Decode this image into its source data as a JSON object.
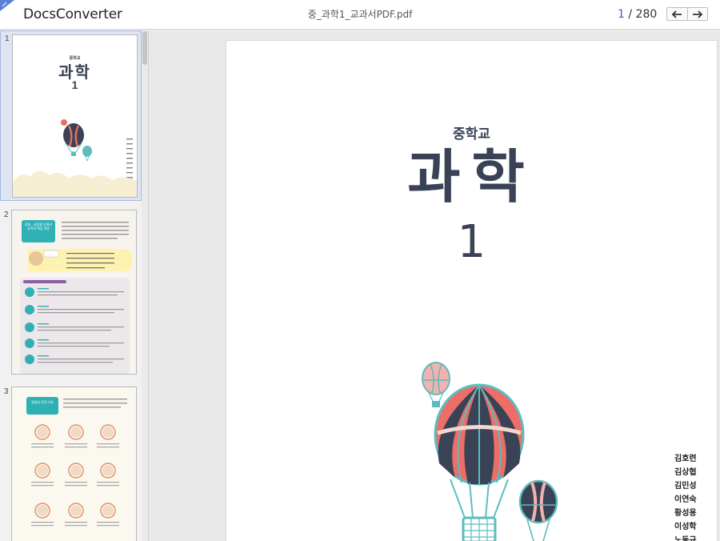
{
  "app": {
    "title": "DocsConverter"
  },
  "file": {
    "name": "중_과학1_교과서PDF.pdf"
  },
  "pagination": {
    "current": "1",
    "separator": "/",
    "total": "280"
  },
  "nav": {
    "prev_icon": "arrow-left-icon",
    "next_icon": "arrow-right-icon"
  },
  "thumbnails": [
    {
      "number": "1"
    },
    {
      "number": "2"
    },
    {
      "number": "3"
    }
  ],
  "cover": {
    "school": "중학교",
    "subject": "과학",
    "volume": "1",
    "authors": [
      "김호련",
      "김상협",
      "김민성",
      "이연숙",
      "황성용",
      "이성학",
      "노동규"
    ]
  },
  "thumb1": {
    "school": "중학교",
    "subject": "과학",
    "volume": "1"
  },
  "thumb2": {
    "callout": "정의 · 공정할 인재의 과학과 핵심 역량"
  },
  "thumb3": {
    "callout": "실험실 안전 기호"
  },
  "colors": {
    "accent": "#3f5fb3",
    "navy": "#3a4256",
    "coral": "#ec6e66",
    "teal": "#5dbcbf"
  }
}
